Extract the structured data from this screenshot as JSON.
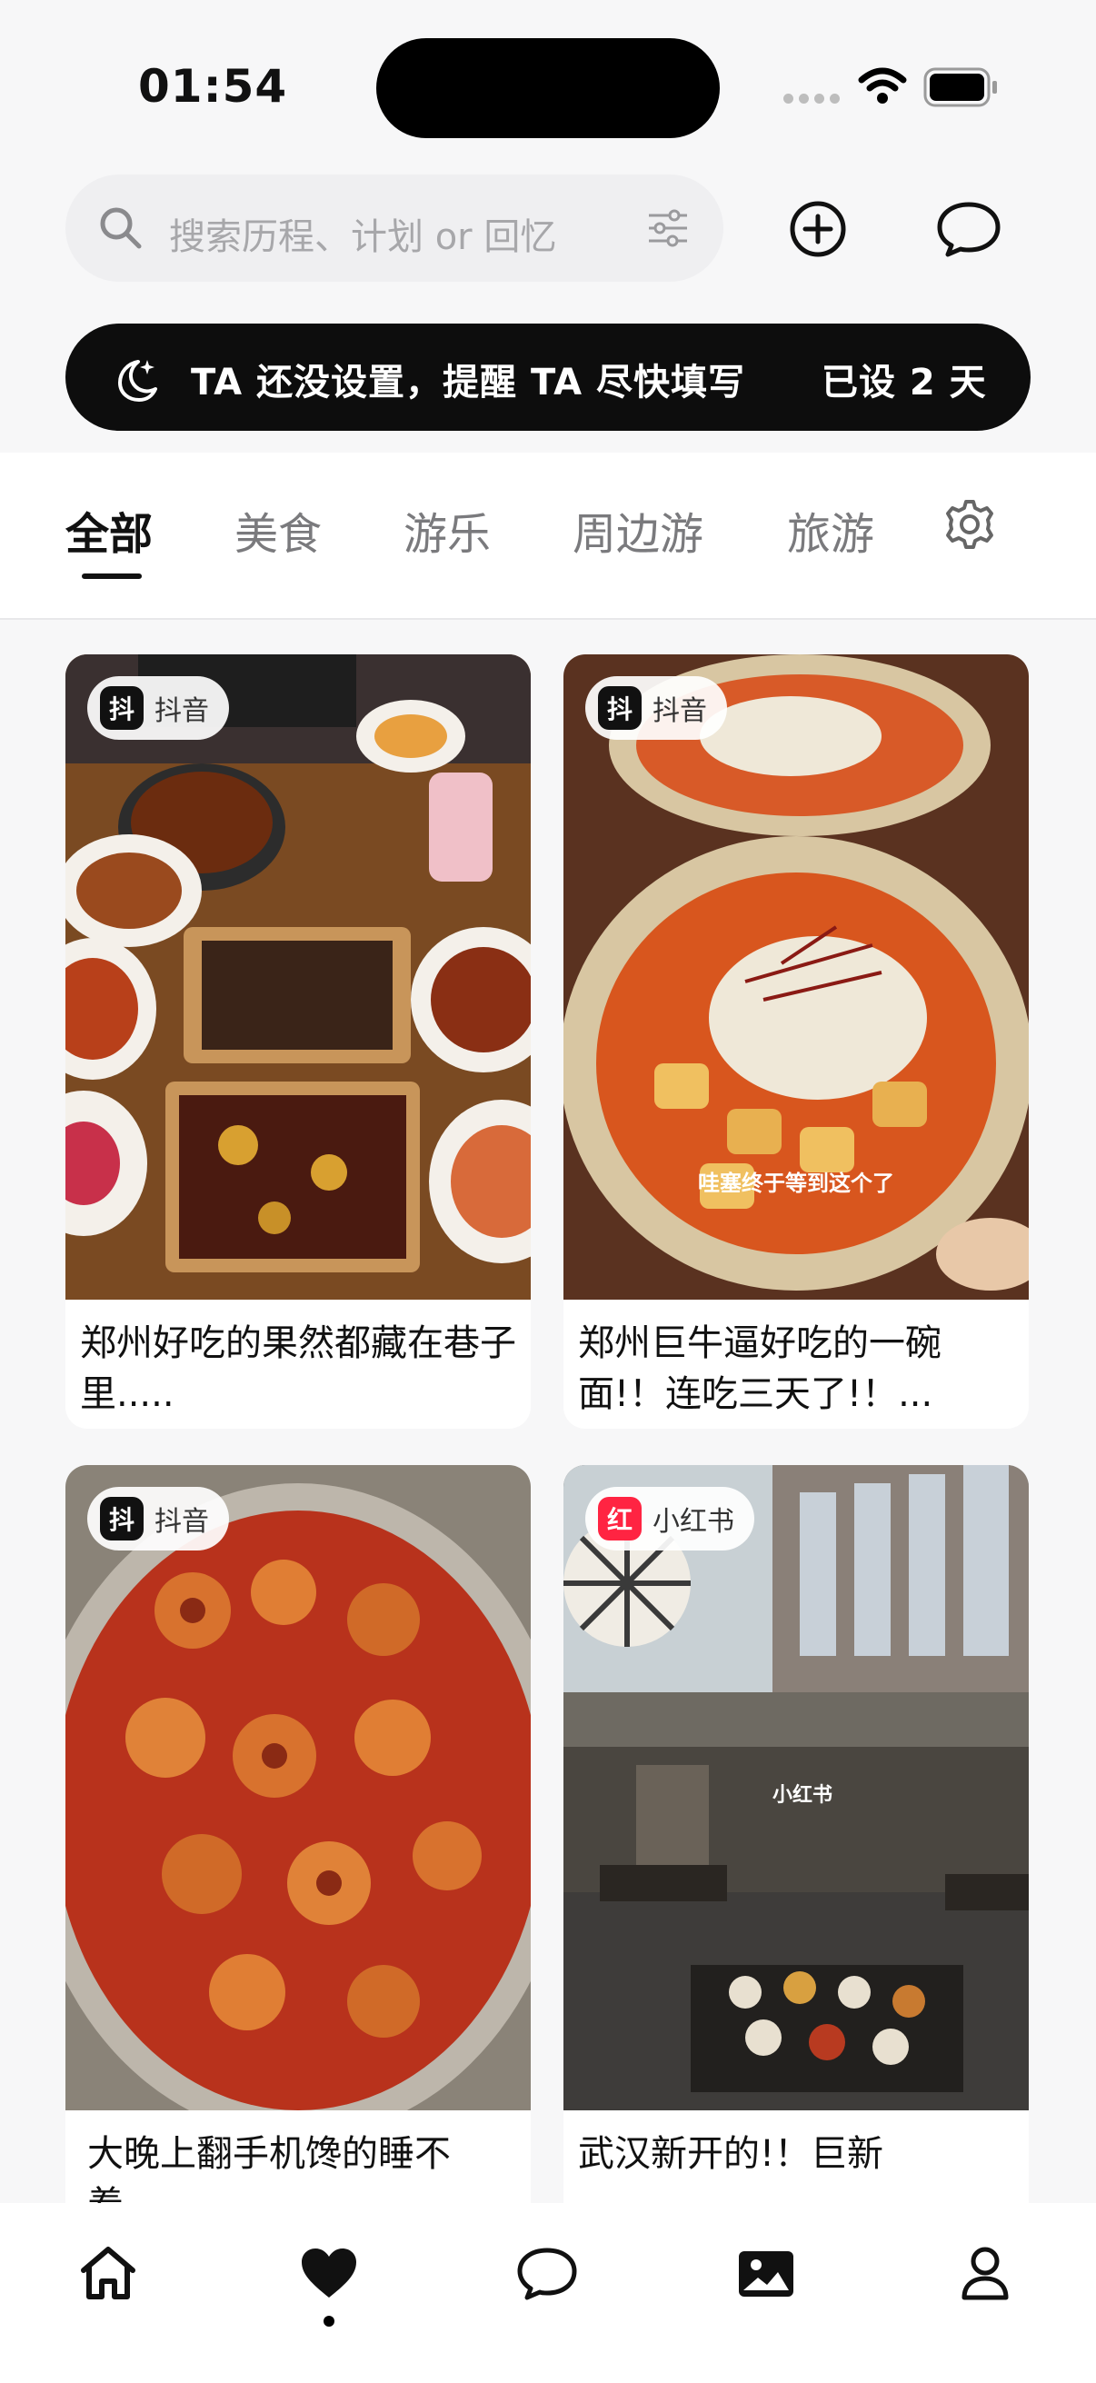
{
  "status_bar": {
    "time": "01:54"
  },
  "search": {
    "placeholder": "搜索历程、计划 or 回忆"
  },
  "banner": {
    "message": "TA 还没设置，提醒 TA 尽快填写",
    "days": "已设 2 天"
  },
  "tabs": [
    {
      "label": "全部",
      "active": true
    },
    {
      "label": "美食",
      "active": false
    },
    {
      "label": "游乐",
      "active": false
    },
    {
      "label": "周边游",
      "active": false
    },
    {
      "label": "旅游",
      "active": false
    }
  ],
  "cards": [
    {
      "source_icon": "抖",
      "source_name": "抖音",
      "title": "郑州好吃的果然都藏在巷子里.....",
      "image": "food-spread-photo"
    },
    {
      "source_icon": "抖",
      "source_name": "抖音",
      "title": "郑州巨牛逼好吃的一碗面!！连吃三天了!！...",
      "image": "noodle-bowl-photo",
      "overlay_caption": "哇塞终于等到这个了"
    },
    {
      "source_icon": "抖",
      "source_name": "抖音",
      "title": "大晚上翻手机馋的睡不着",
      "image": "spicy-seafood-pot-photo"
    },
    {
      "source_icon": "红",
      "source_name": "小红书",
      "title": "武汉新开的!！巨新",
      "image": "restaurant-interior-photo",
      "overlay_caption": "小红书"
    }
  ],
  "colors": {
    "douyin_icon_bg": "#111111",
    "xiaohongshu_icon_bg": "#ff2442",
    "banner_bg": "#0d0d0d",
    "page_bg": "#f7f7f8"
  },
  "icons": {
    "search": "search-icon",
    "filter": "filter-sliders-icon",
    "add": "plus-circle-icon",
    "message": "chat-bubble-icon",
    "moon": "moon-stars-icon",
    "settings": "gear-icon",
    "nav": [
      "home-icon",
      "heart-icon",
      "chat-bubble-icon",
      "image-icon",
      "person-icon"
    ]
  }
}
